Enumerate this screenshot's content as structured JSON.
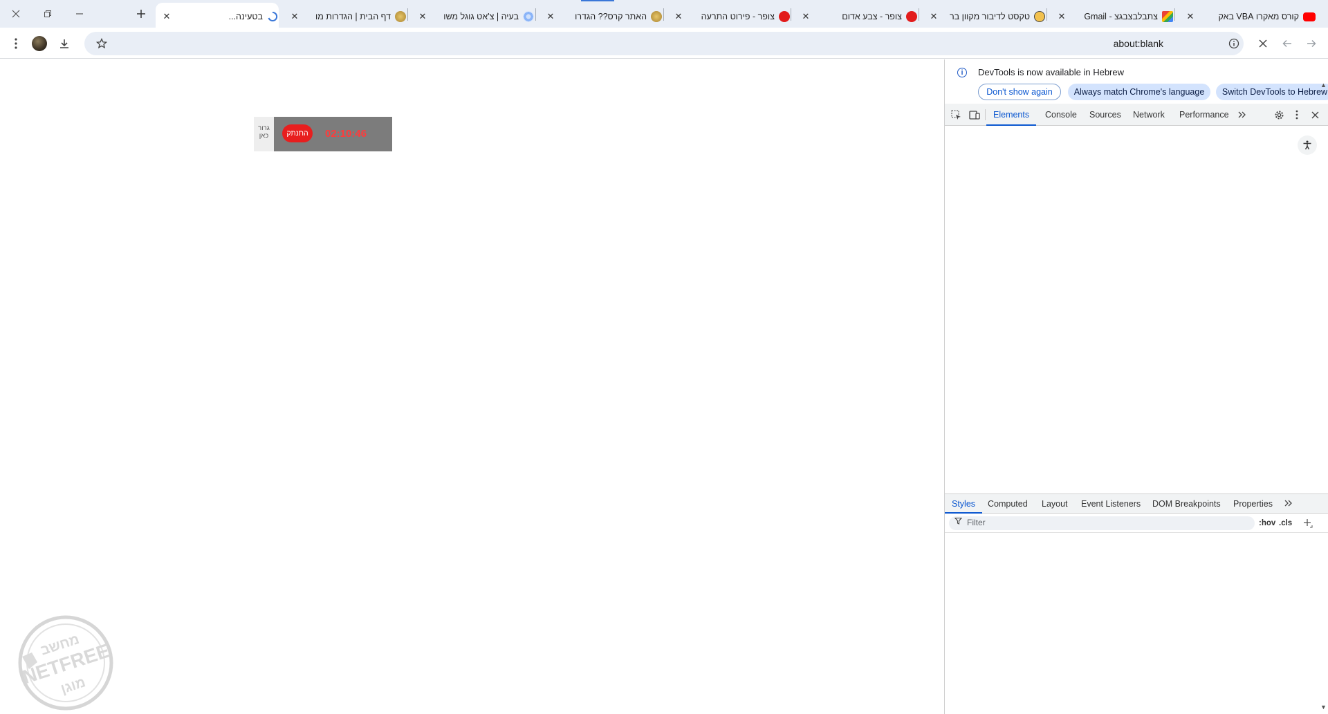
{
  "browser": {
    "tabs": [
      {
        "title": "קורס מאקרו VBA באק",
        "favicon_color": "#ff0000",
        "favicon": "youtube-icon"
      },
      {
        "title": "צתבלבצבגצ - Gmail",
        "favicon_color": "#ea4335",
        "favicon": "gmail-icon"
      },
      {
        "title": "טקסט לדיבור מקוון בר",
        "favicon_color": "#f2c14e",
        "favicon": "smiley-icon"
      },
      {
        "title": "צופר - צבע אדום",
        "favicon_color": "#e21b1b",
        "favicon": "siren-icon"
      },
      {
        "title": "צופר - פירוט התרעה",
        "favicon_color": "#e21b1b",
        "favicon": "siren-icon"
      },
      {
        "title": "האתר קרס?? הגדרו",
        "favicon_color": "#c8a14a",
        "favicon": "netfree-icon"
      },
      {
        "title": "בעיה | צ'אט גוגל משו",
        "favicon_color": "#8ab4f8",
        "favicon": "gear-loader-icon"
      },
      {
        "title": "דף הבית | הגדרות מו",
        "favicon_color": "#c8a14a",
        "favicon": "netfree-icon"
      },
      {
        "title": "בטעינה...",
        "favicon_color": "#3a77d8",
        "favicon": "loading-spinner-icon",
        "active": true
      }
    ],
    "address_bar": {
      "url": "about:blank"
    }
  },
  "page": {
    "widget": {
      "drag_label_line1": "גרור",
      "drag_label_line2": "כאן",
      "disconnect_label": "התנתק",
      "timer": "02:10:46"
    }
  },
  "devtools": {
    "banner": {
      "text": "DevTools is now available in Hebrew",
      "dont_show": "Don't show again",
      "always_match": "Always match Chrome's language",
      "switch": "Switch DevTools to Hebrew"
    },
    "main_tabs": [
      "Elements",
      "Console",
      "Sources",
      "Network",
      "Performance"
    ],
    "active_main_tab": "Elements",
    "styles_tabs": [
      "Styles",
      "Computed",
      "Layout",
      "Event Listeners",
      "DOM Breakpoints",
      "Properties"
    ],
    "active_styles_tab": "Styles",
    "filter_placeholder": "Filter",
    "hov_label": ":hov",
    "cls_label": ".cls"
  }
}
